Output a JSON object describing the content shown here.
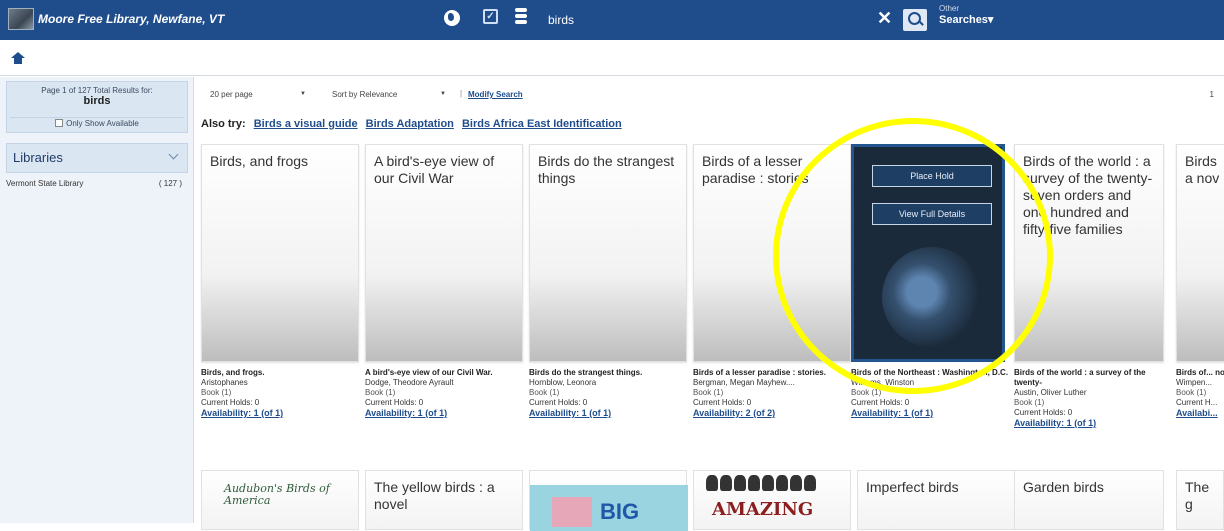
{
  "header": {
    "library_name": "Moore Free Library, Newfane, VT",
    "search_value": "birds",
    "other_small": "Other",
    "other_label": "Searches▾"
  },
  "sidebar": {
    "results_line": "Page 1 of 127 Total Results for:",
    "results_term": "birds",
    "only_available": "Only Show Available",
    "libraries_title": "Libraries",
    "library_item": "Vermont State Library",
    "library_count": "( 127 )"
  },
  "toolbar": {
    "per_page": "20 per page",
    "sort": "Sort by Relevance",
    "modify": "Modify Search",
    "page": "1"
  },
  "also_try": {
    "label": "Also try:",
    "links": [
      "Birds a visual guide",
      "Birds Adaptation",
      "Birds Africa East Identification"
    ]
  },
  "cards": [
    {
      "cover": "Birds, and frogs",
      "title": "Birds, and frogs.",
      "author": "Aristophanes",
      "format": "Book (1)",
      "holds": "Current Holds: 0",
      "availability": "Availability: 1 (of 1)"
    },
    {
      "cover": "A bird's-eye view of our Civil War",
      "title": "A bird's-eye view of our Civil War.",
      "author": "Dodge, Theodore Ayrault",
      "format": "Book (1)",
      "holds": "Current Holds: 0",
      "availability": "Availability: 1 (of 1)"
    },
    {
      "cover": "Birds do the strangest things",
      "title": "Birds do the strangest things.",
      "author": "Hornblow, Leonora",
      "format": "Book (1)",
      "holds": "Current Holds: 0",
      "availability": "Availability: 1 (of 1)"
    },
    {
      "cover": "Birds of a lesser paradise : stories",
      "title": "Birds of a lesser paradise : stories.",
      "author": "Bergman, Megan Mayhew....",
      "format": "Book (1)",
      "holds": "Current Holds: 0",
      "availability": "Availability: 2 (of 2)"
    },
    {
      "cover": "",
      "title": "Birds of the Northeast : Washington, D.C.",
      "author": "Williams, Winston",
      "format": "Book (1)",
      "holds": "Current Holds: 0",
      "availability": "Availability: 1 (of 1)",
      "place_hold": "Place Hold",
      "view_details": "View Full Details"
    },
    {
      "cover": "Birds of the world : a survey of the twenty-seven orders and one hundred and fifty-five families",
      "title": "Birds of the world : a survey of the twenty-",
      "author": "Austin, Oliver Luther",
      "format": "Book (1)",
      "holds": "Current Holds: 0",
      "availability": "Availability: 1 (of 1)"
    },
    {
      "cover": "Birds a nov",
      "title": "Birds of... novel.",
      "author": "Wimpen...",
      "format": "Book (1)",
      "holds": "Current H...",
      "availability": "Availabi..."
    }
  ],
  "row2": [
    {
      "cover": "Audubon's Birds of America"
    },
    {
      "cover": "The yellow birds : a novel"
    },
    {
      "cover": "BIG"
    },
    {
      "cover": "AMAZING"
    },
    {
      "cover": "Imperfect birds"
    },
    {
      "cover": "Garden birds"
    },
    {
      "cover": "The g"
    }
  ],
  "colors": {
    "header": "#1f4d8c",
    "link": "#1f4d8c",
    "highlight": "#ffff00"
  }
}
